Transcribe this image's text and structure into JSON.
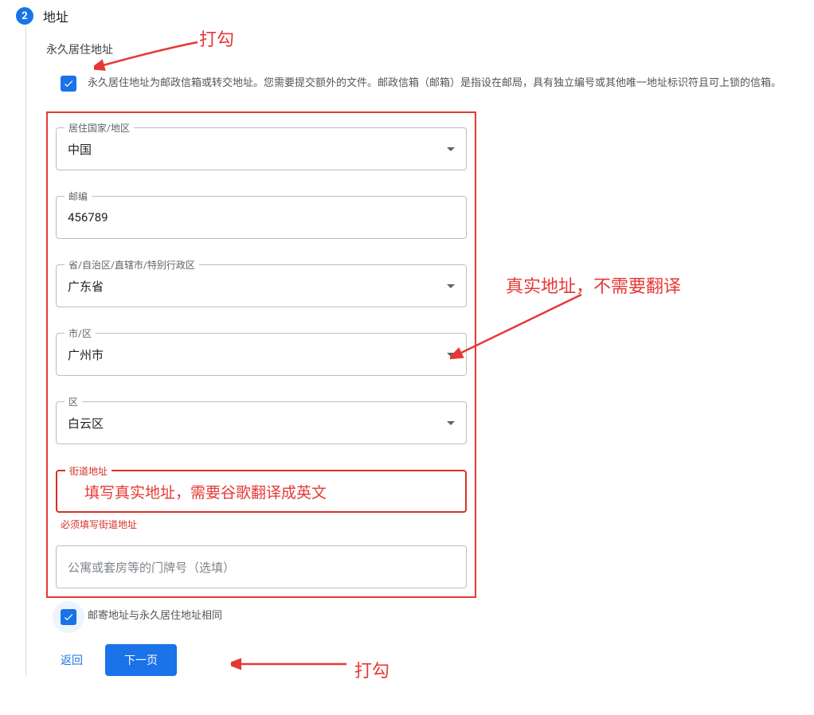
{
  "step": {
    "number": "2",
    "title": "地址"
  },
  "permanent_address": {
    "subtitle": "永久居住地址",
    "checkbox_text": "永久居住地址为邮政信箱或转交地址。您需要提交额外的文件。邮政信箱（邮箱）是指设在邮局，具有独立编号或其他唯一地址标识符且可上锁的信箱。"
  },
  "fields": {
    "country": {
      "label": "居住国家/地区",
      "value": "中国"
    },
    "postcode": {
      "label": "邮编",
      "value": "456789"
    },
    "province": {
      "label": "省/自治区/直辖市/特别行政区",
      "value": "广东省"
    },
    "city": {
      "label": "市/区",
      "value": "广州市"
    },
    "district": {
      "label": "区",
      "value": "白云区"
    },
    "street": {
      "label": "街道地址",
      "error": "必须填写街道地址"
    },
    "apartment": {
      "placeholder": "公寓或套房等的门牌号（选填）"
    }
  },
  "mailing_same": {
    "text": "邮寄地址与永久居住地址相同"
  },
  "buttons": {
    "back": "返回",
    "next": "下一页"
  },
  "annotations": {
    "check1": "打勾",
    "real_address": "真实地址，不需要翻译",
    "street_hint": "填写真实地址，需要谷歌翻译成英文",
    "check2": "打勾"
  }
}
